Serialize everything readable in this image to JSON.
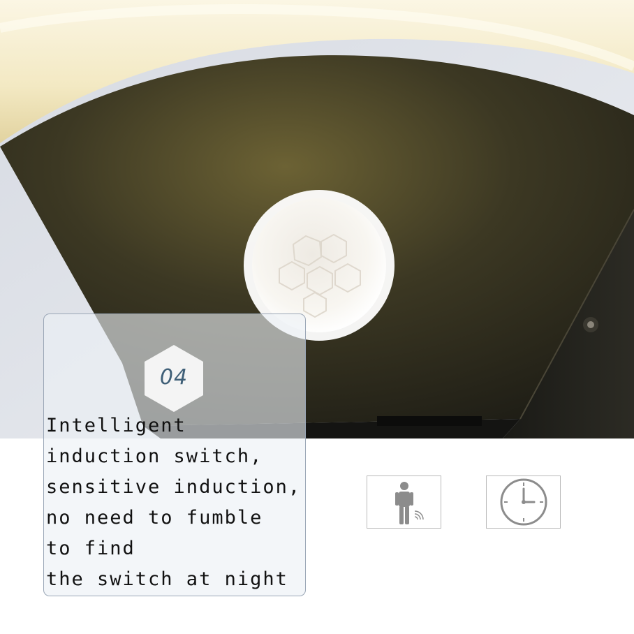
{
  "badge": {
    "number": "04"
  },
  "feature": {
    "lines": [
      "Intelligent",
      "induction switch,",
      "sensitive induction,",
      "no need to fumble",
      "to find",
      "the switch at night"
    ]
  },
  "icons": {
    "motion": "person-motion-sensor-icon",
    "clock": "clock-icon"
  },
  "colors": {
    "lamp_body": "#2b2a1f",
    "lamp_glow": "#f4eccb",
    "sensor_dome": "#f6f3ee",
    "badge_text": "#3f5f77",
    "icon_gray": "#8c8c8c"
  }
}
